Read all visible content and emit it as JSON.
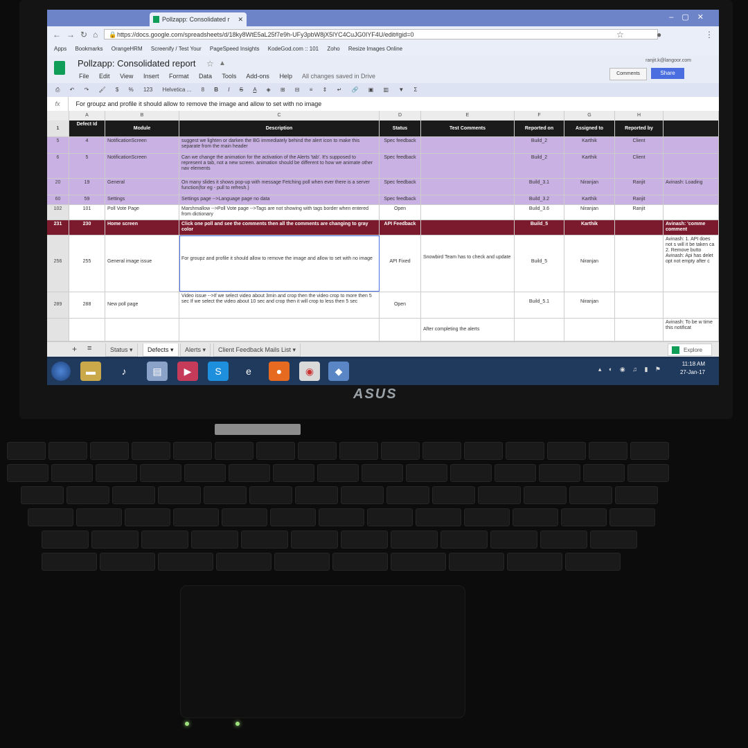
{
  "browser": {
    "tab_title": "Pollzapp: Consolidated r",
    "url": "https://docs.google.com/spreadsheets/d/18ky8WtE5aL25f7e9h-UFy3pbW8jX5lYC4CuJG0IYF4U/edit#gid=0",
    "bookmarks": [
      "Apps",
      "Bookmarks",
      "OrangeHRM",
      "Screenify / Test Your",
      "PageSpeed Insights",
      "KodeGod.com :: 101",
      "Zoho",
      "Resize Images Online"
    ]
  },
  "sheet": {
    "title": "Pollzapp: Consolidated report",
    "status": "All changes saved in Drive",
    "user_email": "ranjit.k@langoor.com",
    "menus": [
      "File",
      "Edit",
      "View",
      "Insert",
      "Format",
      "Data",
      "Tools",
      "Add-ons",
      "Help"
    ],
    "comments_label": "Comments",
    "share_label": "Share",
    "toolbar": {
      "zoom": "123",
      "font": "Helvetica ...",
      "size": "8"
    },
    "formula": "For groupz and profile it should allow to remove the image and allow to set with no image",
    "fx_label": "fx"
  },
  "columns": [
    "A",
    "B",
    "C",
    "D",
    "E",
    "F",
    "G",
    "H"
  ],
  "headers": [
    "Defect Id",
    "Module",
    "Description",
    "Status",
    "Test Comments",
    "Reported on",
    "Assigned to",
    "Reported by"
  ],
  "rows": [
    {
      "rn": "5",
      "id": "4",
      "module": "NotificationScreen",
      "desc": "suggest we lighten or darken the BG immediately behind the alert icon to make this separate from the main header",
      "status": "Spec feedback",
      "comments": "",
      "reported_on": "Build_2",
      "assigned": "Karthik",
      "reported_by": "Client",
      "extra": ""
    },
    {
      "rn": "6",
      "id": "5",
      "module": "NotificationScreen",
      "desc": "Can we change the animation for the activation of the Alerts 'tab'. It's supposed to represent a tab, not a new screen. animation should be different to how we animate other nav elements",
      "status": "Spec feedback",
      "comments": "",
      "reported_on": "Build_2",
      "assigned": "Karthik",
      "reported_by": "Client",
      "extra": ""
    },
    {
      "rn": "20",
      "id": "19",
      "module": "General",
      "desc": "On many slides it shows pop-up with message Fetching poll when ever there is a server function(for eg - pull to refresh.)",
      "status": "Spec feedback",
      "comments": "",
      "reported_on": "Build_3.1",
      "assigned": "Niranjan",
      "reported_by": "Ranjit",
      "extra": "Avinash: Loading"
    },
    {
      "rn": "60",
      "id": "59",
      "module": "Settings",
      "desc": "Settings page -->Language page no data",
      "status": "Spec feedback",
      "comments": "",
      "reported_on": "Build_3.2",
      "assigned": "Karthik",
      "reported_by": "Ranjit",
      "extra": ""
    },
    {
      "rn": "102",
      "id": "101",
      "module": "Poll Vote Page",
      "desc": "Marshmallow -->Poll Vote page -->Tags are not showing with tags border when entered from dictionary",
      "status": "Open",
      "comments": "",
      "reported_on": "Build_3.6",
      "assigned": "Niranjan",
      "reported_by": "Ranjit",
      "extra": ""
    },
    {
      "rn": "231",
      "id": "230",
      "module": "Home screen",
      "desc": "Click one poll and see the comments then all the comments are changing to gray color",
      "status": "API Feedback",
      "comments": "",
      "reported_on": "Build_5",
      "assigned": "Karthik",
      "reported_by": "",
      "extra": "Avinash: 'comme comment"
    },
    {
      "rn": "256",
      "id": "255",
      "module": "General image issue",
      "desc": "For groupz and profile it should allow to remove the image and allow to set with no image",
      "status": "API Fixed",
      "comments": "Snowbird Team has to check and update",
      "reported_on": "Build_5",
      "assigned": "Niranjan",
      "reported_by": "",
      "extra": "Avinash: 1. API does not s will it be taken ca 2. Remove butto Avinash: Api has delet opt not empty after c"
    },
    {
      "rn": "289",
      "id": "288",
      "module": "New poll page",
      "desc": "Video issue -->If we select video about 3min and crop then the video crop to more then 5 sec If we select the video about 10 sec and crop then it will crop to less then 5 sec",
      "status": "Open",
      "comments": "",
      "reported_on": "Build_5.1",
      "assigned": "Niranjan",
      "reported_by": "",
      "extra": ""
    },
    {
      "rn": "",
      "id": "",
      "module": "",
      "desc": "",
      "status": "",
      "comments": "After completing the alerts",
      "reported_on": "",
      "assigned": "",
      "reported_by": "",
      "extra": "Avinash: To be w time this notificat"
    }
  ],
  "sheet_tabs": [
    "Status",
    "Defects",
    "Alerts",
    "Client Feedback Mails List"
  ],
  "explore_label": "Explore",
  "taskbar": {
    "time": "11:18 AM",
    "date": "27-Jan-17"
  },
  "brand": "ASUS",
  "colors": {
    "purple_row": "#c9b2e3",
    "maroon_row": "#7a1a2c",
    "header_row": "#1b1b1b",
    "share_button": "#4a6ee0",
    "sheets_green": "#0f9d58"
  }
}
